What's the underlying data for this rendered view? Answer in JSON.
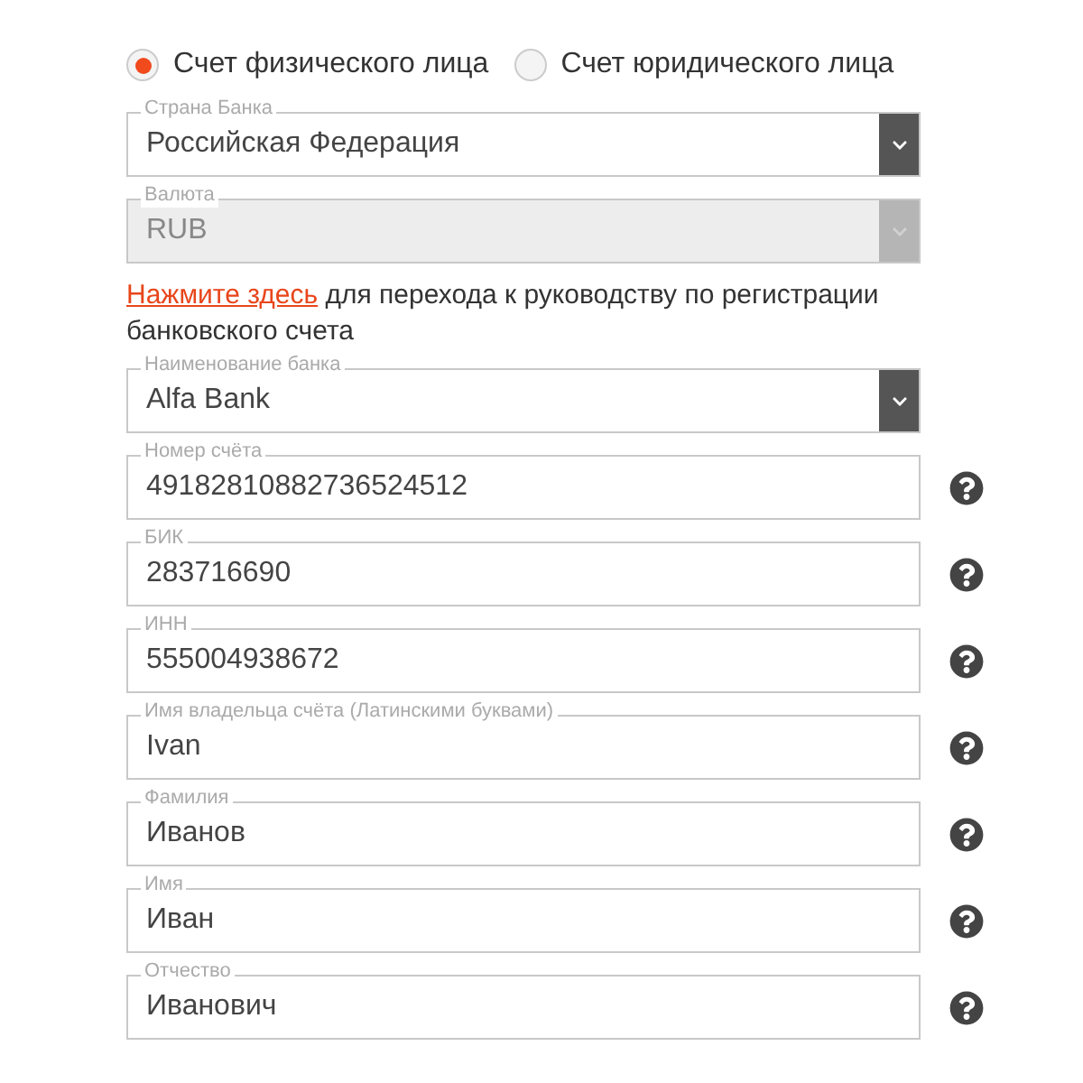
{
  "account_type": [
    {
      "label": "Счет физического лица",
      "selected": true
    },
    {
      "label": "Счет юридического лица",
      "selected": false
    }
  ],
  "fields_top": [
    {
      "kind": "select",
      "label": "Страна Банка",
      "value": "Российская Федерация",
      "disabled": false,
      "help": false
    },
    {
      "kind": "select",
      "label": "Валюта",
      "value": "RUB",
      "disabled": true,
      "help": false
    }
  ],
  "guide": {
    "link": "Нажмите здесь",
    "text": "для перехода к руководству по регистрации банковского счета"
  },
  "fields": [
    {
      "kind": "select",
      "label": "Наименование банка",
      "value": "Alfa Bank",
      "disabled": false,
      "help": false
    },
    {
      "kind": "text",
      "label": "Номер счёта",
      "value": "49182810882736524512",
      "disabled": false,
      "help": true
    },
    {
      "kind": "text",
      "label": "БИК",
      "value": "283716690",
      "disabled": false,
      "help": true
    },
    {
      "kind": "text",
      "label": "ИНН",
      "value": "555004938672",
      "disabled": false,
      "help": true
    },
    {
      "kind": "text",
      "label": "Имя владельца счёта (Латинскими буквами)",
      "value": "Ivan",
      "disabled": false,
      "help": true
    },
    {
      "kind": "text",
      "label": "Фамилия",
      "value": "Иванов",
      "disabled": false,
      "help": true
    },
    {
      "kind": "text",
      "label": "Имя",
      "value": "Иван",
      "disabled": false,
      "help": true
    },
    {
      "kind": "text",
      "label": "Отчество",
      "value": "Иванович",
      "disabled": false,
      "help": true
    }
  ]
}
